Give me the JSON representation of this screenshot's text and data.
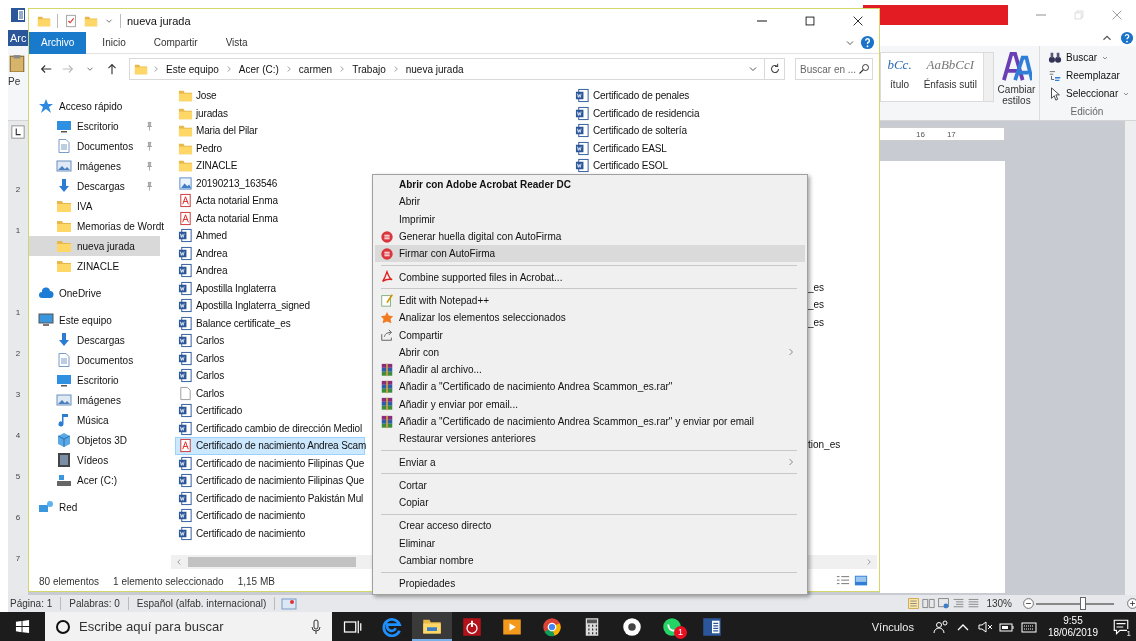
{
  "word": {
    "file_tab": "Arc",
    "paste_label": "Pe",
    "styles": [
      {
        "kind": "heading",
        "preview": "bCc.",
        "label": "ítulo"
      },
      {
        "kind": "subtle",
        "preview": "AaBbCcI",
        "label": "Énfasis sutil"
      }
    ],
    "change_styles": "Cambiar estilos",
    "editing": {
      "commands": [
        {
          "kind": "find",
          "label": "Buscar",
          "dropdown": true
        },
        {
          "kind": "replace",
          "label": "Reemplazar",
          "dropdown": false
        },
        {
          "kind": "select",
          "label": "Seleccionar",
          "dropdown": true
        }
      ],
      "group_label": "Edición"
    },
    "ruler": [
      "16",
      "17"
    ],
    "vertical_ruler": [
      "2",
      "1",
      "1",
      "2",
      "3",
      "4",
      "5",
      "6",
      "7"
    ],
    "status_bar": {
      "page": "Página: 1",
      "words": "Palabras: 0",
      "language": "Español (alfab. internacional)",
      "zoom": "130%",
      "zoom_slider": {
        "level": 0.6
      }
    }
  },
  "explorer": {
    "title": "nueva jurada",
    "ribbon_tabs": [
      {
        "label": "Archivo",
        "selected": true
      },
      {
        "label": "Inicio",
        "selected": false
      },
      {
        "label": "Compartir",
        "selected": false
      },
      {
        "label": "Vista",
        "selected": false
      }
    ],
    "breadcrumb": [
      "Este equipo",
      "Acer (C:)",
      "carmen",
      "Trabajo",
      "nueva jurada"
    ],
    "search": {
      "placeholder": "Buscar en ..."
    },
    "sidebar": [
      {
        "label": "Acceso rápido",
        "kind": "star",
        "selected": false,
        "children": [
          {
            "label": "Escritorio",
            "kind": "desktop",
            "pinned": true,
            "selected": false
          },
          {
            "label": "Documentos",
            "kind": "documents",
            "pinned": true,
            "selected": false
          },
          {
            "label": "Imágenes",
            "kind": "pictures",
            "pinned": true,
            "selected": false
          },
          {
            "label": "Descargas",
            "kind": "downloads",
            "pinned": true,
            "selected": false
          },
          {
            "label": "IVA",
            "kind": "folder",
            "pinned": false,
            "selected": false
          },
          {
            "label": "Memorias de Wordt",
            "kind": "folder",
            "pinned": false,
            "selected": false
          },
          {
            "label": "nueva jurada",
            "kind": "folder",
            "pinned": false,
            "selected": true
          },
          {
            "label": "ZINACLE",
            "kind": "folder",
            "pinned": false,
            "selected": false
          }
        ]
      },
      {
        "label": "OneDrive",
        "kind": "cloud",
        "selected": false
      },
      {
        "label": "Este equipo",
        "kind": "computer",
        "selected": false,
        "children": [
          {
            "label": "Descargas",
            "kind": "downloads",
            "pinned": false,
            "selected": false
          },
          {
            "label": "Documentos",
            "kind": "documents",
            "pinned": false,
            "selected": false
          },
          {
            "label": "Escritorio",
            "kind": "desktop",
            "pinned": false,
            "selected": false
          },
          {
            "label": "Imágenes",
            "kind": "pictures",
            "pinned": false,
            "selected": false
          },
          {
            "label": "Música",
            "kind": "music",
            "pinned": false,
            "selected": false
          },
          {
            "label": "Objetos 3D",
            "kind": "cube",
            "pinned": false,
            "selected": false
          },
          {
            "label": "Vídeos",
            "kind": "video",
            "pinned": false,
            "selected": false
          },
          {
            "label": "Acer (C:)",
            "kind": "drive",
            "pinned": false,
            "selected": false
          }
        ]
      },
      {
        "label": "Red",
        "kind": "network",
        "selected": false
      }
    ],
    "files": {
      "column_1": [
        {
          "name": "Jose",
          "kind": "folder",
          "selected": false
        },
        {
          "name": "juradas",
          "kind": "folder",
          "selected": false
        },
        {
          "name": "Maria del Pilar",
          "kind": "folder",
          "selected": false
        },
        {
          "name": "Pedro",
          "kind": "folder",
          "selected": false
        },
        {
          "name": "ZINACLE",
          "kind": "folder",
          "selected": false
        },
        {
          "name": "20190213_163546",
          "kind": "image",
          "selected": false
        },
        {
          "name": "Acta notarial Enma",
          "kind": "pdf",
          "selected": false
        },
        {
          "name": "Acta notarial Enma",
          "kind": "pdf",
          "selected": false
        },
        {
          "name": "Ahmed",
          "kind": "doc",
          "selected": false
        },
        {
          "name": "Andrea",
          "kind": "doc",
          "selected": false
        },
        {
          "name": "Andrea",
          "kind": "doc",
          "selected": false
        },
        {
          "name": "Apostilla Inglaterra",
          "kind": "doc",
          "selected": false
        },
        {
          "name": "Apostilla Inglaterra_signed",
          "kind": "doc",
          "selected": false
        },
        {
          "name": "Balance certificate_es",
          "kind": "doc",
          "selected": false
        },
        {
          "name": "Carlos",
          "kind": "doc",
          "selected": false
        },
        {
          "name": "Carlos",
          "kind": "doc",
          "selected": false
        },
        {
          "name": "Carlos",
          "kind": "doc",
          "selected": false
        },
        {
          "name": "Carlos",
          "kind": "file",
          "selected": false
        },
        {
          "name": "Certificado",
          "kind": "doc",
          "selected": false
        },
        {
          "name": "Certificado cambio de dirección Mediol",
          "kind": "doc",
          "selected": false
        },
        {
          "name": "Certificado de nacimiento Andrea Scam",
          "kind": "pdf",
          "selected": true
        },
        {
          "name": "Certificado de nacimiento Filipinas Que",
          "kind": "doc",
          "selected": false
        },
        {
          "name": "Certificado de nacimiento Filipinas Que",
          "kind": "doc",
          "selected": false
        },
        {
          "name": "Certificado de nacimiento Pakistán Mul",
          "kind": "doc",
          "selected": false
        },
        {
          "name": "Certificado de nacimiento",
          "kind": "doc",
          "selected": false
        },
        {
          "name": "Certificado de nacimiento",
          "kind": "doc",
          "selected": false
        }
      ],
      "column_2": [
        {
          "name": "Certificado de penales",
          "kind": "doc",
          "selected": false
        },
        {
          "name": "Certificado de residencia",
          "kind": "doc",
          "selected": false
        },
        {
          "name": "Certificado de soltería",
          "kind": "doc",
          "selected": false
        },
        {
          "name": "Certificado EASL",
          "kind": "doc",
          "selected": false
        },
        {
          "name": "Certificado ESOL",
          "kind": "doc",
          "selected": false
        }
      ],
      "column_2_fragments": [
        "_es",
        "_es",
        "_es",
        "tion_es"
      ]
    },
    "status_bar": {
      "count": "80 elementos",
      "selection": "1 elemento seleccionado",
      "size": "1,15 MB"
    }
  },
  "context_menu": [
    {
      "kind": "plain",
      "label": "Abrir con Adobe Acrobat Reader DC",
      "default": true,
      "submenu": false,
      "selected": false
    },
    {
      "kind": "plain",
      "label": "Abrir",
      "default": false,
      "submenu": false,
      "selected": false
    },
    {
      "kind": "plain",
      "label": "Imprimir",
      "default": false,
      "submenu": false,
      "selected": false
    },
    {
      "kind": "autofirma",
      "label": "Generar huella digital con AutoFirma",
      "default": false,
      "submenu": false,
      "selected": false
    },
    {
      "kind": "autofirma",
      "label": "Firmar con AutoFirma",
      "default": false,
      "submenu": false,
      "selected": true
    },
    {
      "kind": "separator"
    },
    {
      "kind": "acrobat",
      "label": "Combine supported files in Acrobat...",
      "default": false,
      "submenu": false,
      "selected": false
    },
    {
      "kind": "separator"
    },
    {
      "kind": "notepad",
      "label": "Edit with Notepad++",
      "default": false,
      "submenu": false,
      "selected": false
    },
    {
      "kind": "scan",
      "label": "Analizar los elementos seleccionados",
      "default": false,
      "submenu": false,
      "selected": false
    },
    {
      "kind": "share",
      "label": "Compartir",
      "default": false,
      "submenu": false,
      "selected": false
    },
    {
      "kind": "plain",
      "label": "Abrir con",
      "default": false,
      "submenu": true,
      "selected": false
    },
    {
      "kind": "archive",
      "label": "Añadir al archivo...",
      "default": false,
      "submenu": false,
      "selected": false
    },
    {
      "kind": "archive",
      "label": "Añadir a \"Certificado de nacimiento Andrea Scammon_es.rar\"",
      "default": false,
      "submenu": false,
      "selected": false
    },
    {
      "kind": "archive",
      "label": "Añadir y enviar por email...",
      "default": false,
      "submenu": false,
      "selected": false
    },
    {
      "kind": "archive",
      "label": "Añadir a \"Certificado de nacimiento Andrea Scammon_es.rar\" y enviar por email",
      "default": false,
      "submenu": false,
      "selected": false
    },
    {
      "kind": "plain",
      "label": "Restaurar versiones anteriores",
      "default": false,
      "submenu": false,
      "selected": false
    },
    {
      "kind": "separator"
    },
    {
      "kind": "plain",
      "label": "Enviar a",
      "default": false,
      "submenu": true,
      "selected": false
    },
    {
      "kind": "separator"
    },
    {
      "kind": "plain",
      "label": "Cortar",
      "default": false,
      "submenu": false,
      "selected": false
    },
    {
      "kind": "plain",
      "label": "Copiar",
      "default": false,
      "submenu": false,
      "selected": false
    },
    {
      "kind": "separator"
    },
    {
      "kind": "plain",
      "label": "Crear acceso directo",
      "default": false,
      "submenu": false,
      "selected": false
    },
    {
      "kind": "plain",
      "label": "Eliminar",
      "default": false,
      "submenu": false,
      "selected": false
    },
    {
      "kind": "plain",
      "label": "Cambiar nombre",
      "default": false,
      "submenu": false,
      "selected": false
    },
    {
      "kind": "separator"
    },
    {
      "kind": "plain",
      "label": "Propiedades",
      "default": false,
      "submenu": false,
      "selected": false
    }
  ],
  "taskbar": {
    "search": {
      "placeholder": "Escribe aquí para buscar"
    },
    "apps": [
      {
        "kind": "task-view",
        "active": false
      },
      {
        "kind": "browser",
        "active": false
      },
      {
        "kind": "explorer",
        "active": true
      },
      {
        "kind": "power",
        "active": false
      },
      {
        "kind": "media",
        "active": false
      },
      {
        "kind": "chrome",
        "active": false
      },
      {
        "kind": "calculator",
        "active": false
      },
      {
        "kind": "circle",
        "active": false
      },
      {
        "kind": "chat",
        "active": false,
        "badge": "1"
      },
      {
        "kind": "word",
        "active": false
      }
    ],
    "links_label": "Vínculos",
    "time": "9:55",
    "date": "18/06/2019",
    "notification_count": "1"
  }
}
